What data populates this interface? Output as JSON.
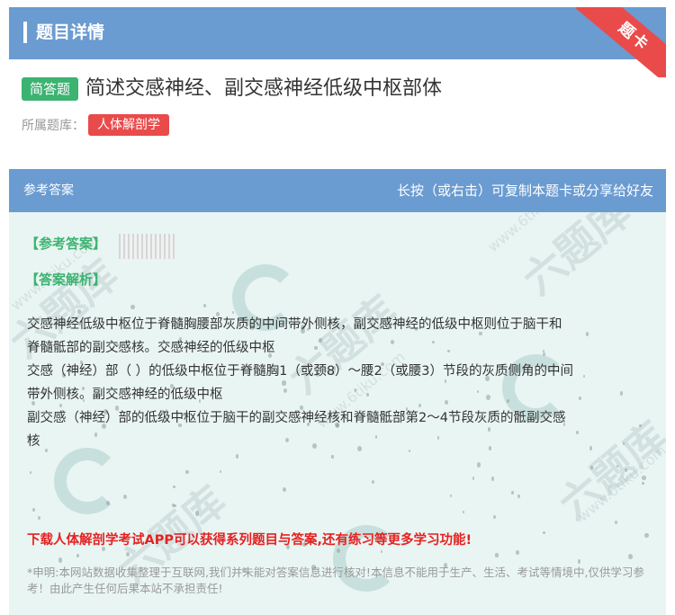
{
  "header": {
    "title": "题目详情",
    "ribbon_label": "题卡"
  },
  "question": {
    "type_tag": "简答题",
    "text": "简述交感神经、副交感神经低级中枢部体"
  },
  "bank": {
    "label": "所属题库：",
    "name": "人体解剖学"
  },
  "answer_card": {
    "header_left": "参考答案",
    "header_right": "长按（或右击）可复制本题卡或分享给好友",
    "ref_answer_label": "【参考答案】",
    "analysis_label": "【答案解析】",
    "analysis_lines": [
      "交感神经低级中枢位于脊髓胸腰部灰质的中间带外侧核，副交感神经的低级中枢则位于脑干和",
      "脊髓骶部的副交感核。交感神经的低级中枢",
      "交感（神经）部（ ）的低级中枢位于脊髓胸1（或颈8）～腰2（或腰3）节段的灰质侧角的中间",
      "带外侧核。副交感神经的低级中枢",
      "副交感（神经）部的低级中枢位于脑干的副交感神经核和脊髓骶部第2～4节段灰质的骶副交感",
      "核"
    ],
    "promo": "下载人体解剖学考试APP可以获得系列题目与答案,还有练习等更多学习功能!",
    "disclaimer": "*申明:本网站数据收集整理于互联网,我们并未能对答案信息进行核对!本信息不能用于生产、生活、考试等情境中,仅供学习参考！由此产生任何后果本站不承担责任!"
  },
  "watermark": {
    "brand": "六题库",
    "url": "www.6tiku.com"
  },
  "colors": {
    "header_blue": "#6a9bd1",
    "answer_bg": "#e9f5f3",
    "tag_green": "#3cb371",
    "tag_red": "#e94b4b",
    "promo_red": "#e52121"
  }
}
